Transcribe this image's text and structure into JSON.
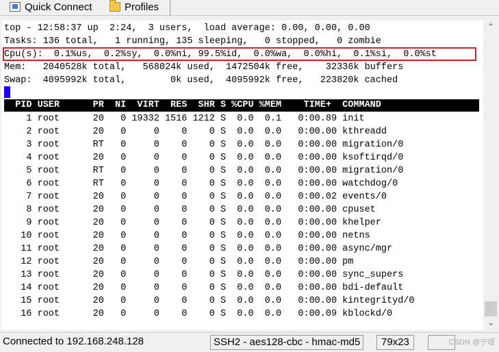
{
  "toolbar": {
    "quick_connect": "Quick Connect",
    "profiles": "Profiles"
  },
  "top": {
    "line1": "top - 12:58:37 up  2:24,  3 users,  load average: 0.00, 0.00, 0.00",
    "line2": "Tasks: 136 total,   1 running, 135 sleeping,   0 stopped,   0 zombie",
    "line3": "Cpu(s):  0.1%us,  0.2%sy,  0.0%ni, 99.5%id,  0.0%wa,  0.0%hi,  0.1%si,  0.0%st",
    "line4": "Mem:   2040528k total,   568024k used,  1472504k free,    32336k buffers",
    "line5": "Swap:  4095992k total,        0k used,  4095992k free,   223820k cached"
  },
  "table": {
    "header": "  PID USER      PR  NI  VIRT  RES  SHR S %CPU %MEM    TIME+  COMMAND",
    "rows": [
      "    1 root      20   0 19332 1516 1212 S  0.0  0.1   0:00.89 init",
      "    2 root      20   0     0    0    0 S  0.0  0.0   0:00.00 kthreadd",
      "    3 root      RT   0     0    0    0 S  0.0  0.0   0:00.00 migration/0",
      "    4 root      20   0     0    0    0 S  0.0  0.0   0:00.00 ksoftirqd/0",
      "    5 root      RT   0     0    0    0 S  0.0  0.0   0:00.00 migration/0",
      "    6 root      RT   0     0    0    0 S  0.0  0.0   0:00.00 watchdog/0",
      "    7 root      20   0     0    0    0 S  0.0  0.0   0:00.02 events/0",
      "    8 root      20   0     0    0    0 S  0.0  0.0   0:00.00 cpuset",
      "    9 root      20   0     0    0    0 S  0.0  0.0   0:00.00 khelper",
      "   10 root      20   0     0    0    0 S  0.0  0.0   0:00.00 netns",
      "   11 root      20   0     0    0    0 S  0.0  0.0   0:00.00 async/mgr",
      "   12 root      20   0     0    0    0 S  0.0  0.0   0:00.00 pm",
      "   13 root      20   0     0    0    0 S  0.0  0.0   0:00.00 sync_supers",
      "   14 root      20   0     0    0    0 S  0.0  0.0   0:00.00 bdi-default",
      "   15 root      20   0     0    0    0 S  0.0  0.0   0:00.00 kintegrityd/0",
      "   16 root      20   0     0    0    0 S  0.0  0.0   0:00.09 kblockd/0"
    ]
  },
  "statusbar": {
    "connection": "Connected to 192.168.248.128",
    "cipher": "SSH2 - aes128-cbc - hmac-md5",
    "size": "79x23",
    "watermark": "CSDN @宁氓"
  },
  "colors": {
    "highlight_box": "#d02020",
    "cursor": "#1a00ff"
  },
  "icons": {
    "quick_connect": "quick-connect-icon",
    "profiles": "folder-icon",
    "scroll_up": "chevron-up-icon",
    "scroll_down": "chevron-down-icon"
  }
}
